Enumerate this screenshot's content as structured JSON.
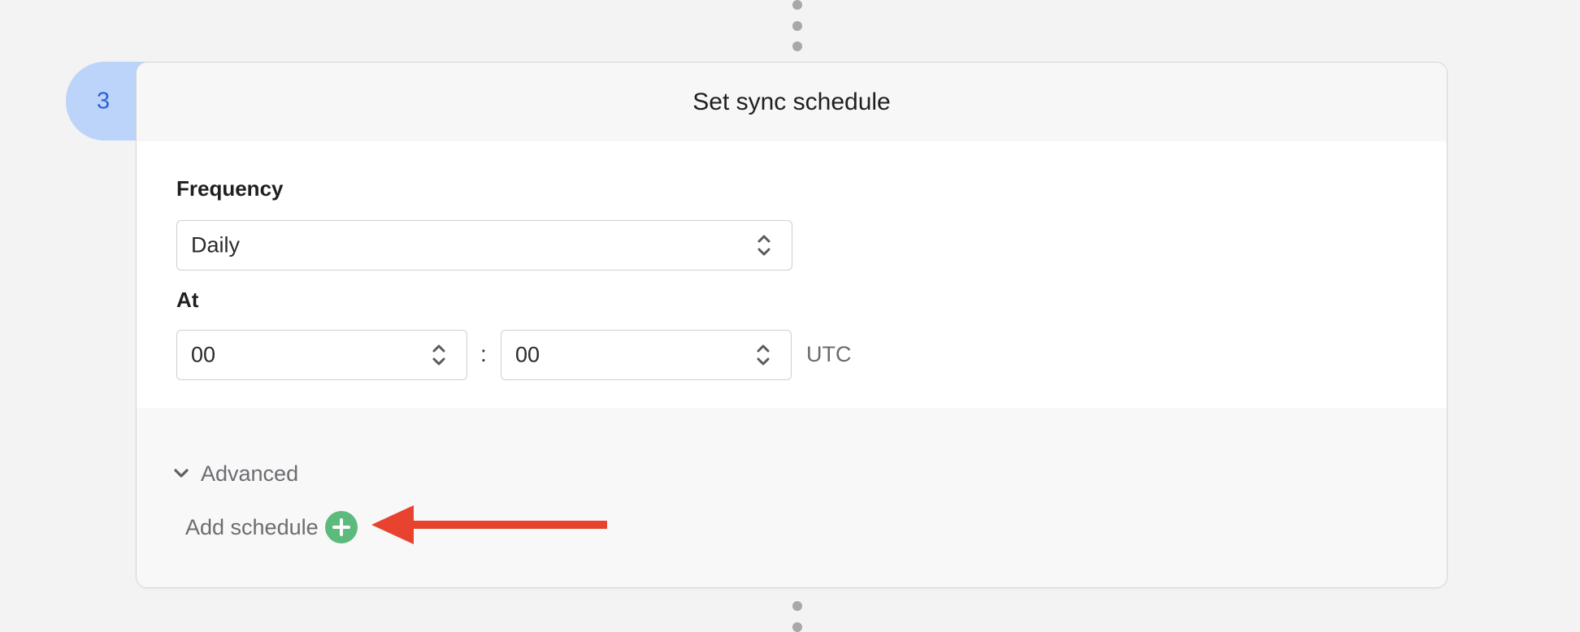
{
  "step": {
    "number": "3",
    "title": "Set sync schedule"
  },
  "frequency": {
    "label": "Frequency",
    "value": "Daily"
  },
  "at": {
    "label": "At",
    "hour": "00",
    "separator": ":",
    "minute": "00",
    "timezone": "UTC"
  },
  "advanced": {
    "label": "Advanced",
    "expanded": true
  },
  "add_schedule": {
    "label": "Add schedule"
  },
  "icons": {
    "chevron": "chevron-down-icon",
    "select": "up-down-chevron-icon",
    "add": "plus-circle-icon",
    "annotation": "red-arrow-icon"
  },
  "colors": {
    "badge_bg": "#bcd4fa",
    "badge_text": "#2e63d6",
    "add_button": "#5cba7d",
    "annotation_arrow": "#e8432e"
  }
}
